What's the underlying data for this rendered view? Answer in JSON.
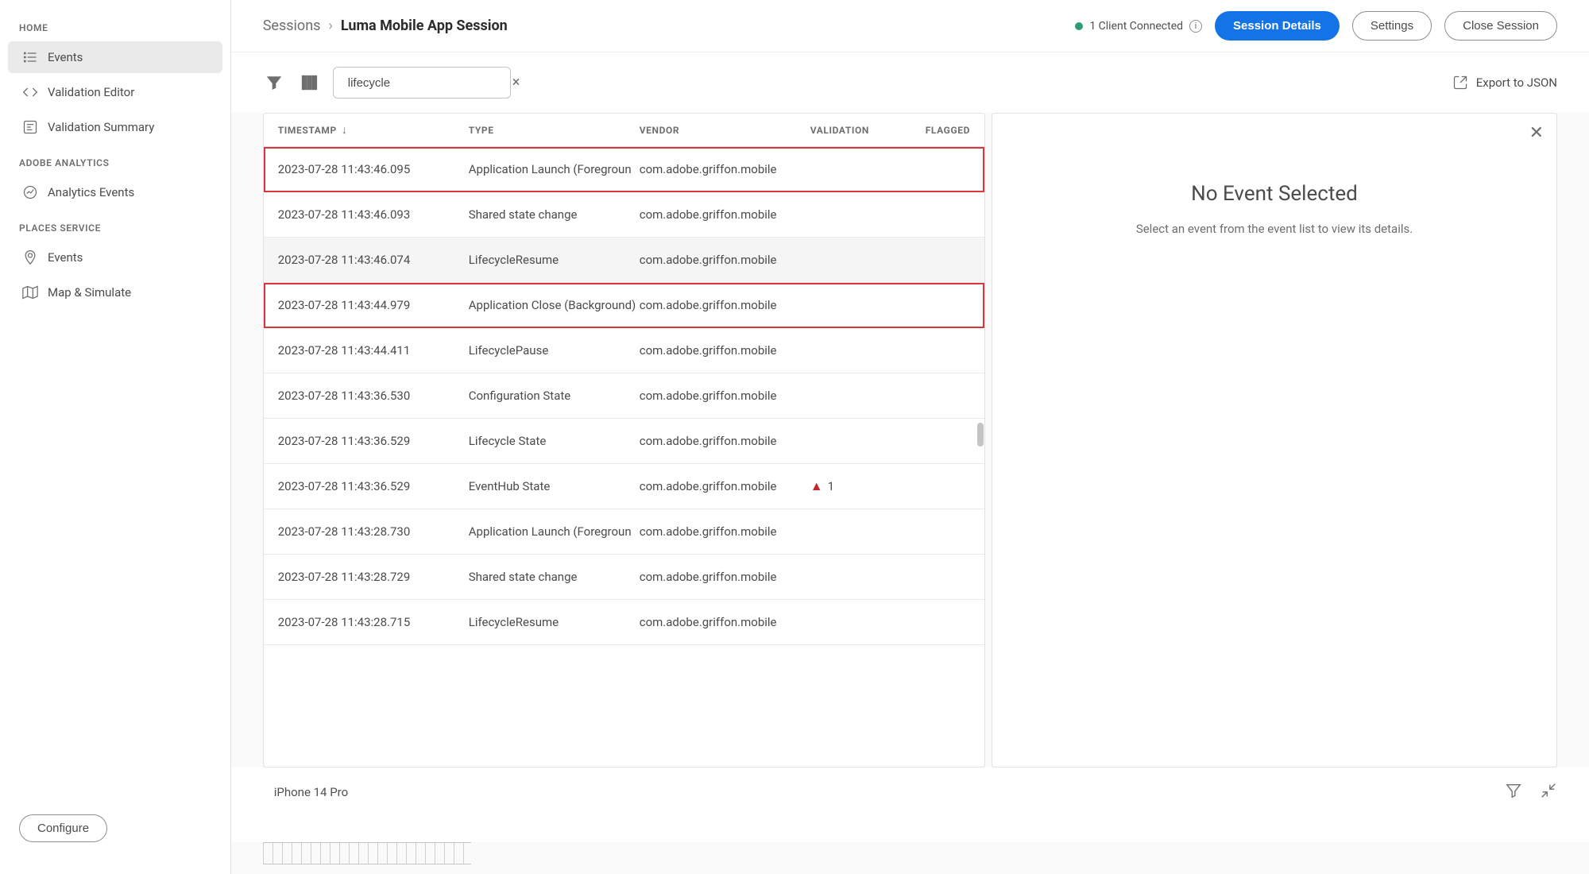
{
  "sidebar": {
    "sections": [
      {
        "title": "HOME",
        "items": [
          {
            "label": "Events",
            "icon": "events-list-icon",
            "active": true
          },
          {
            "label": "Validation Editor",
            "icon": "code-icon"
          },
          {
            "label": "Validation Summary",
            "icon": "summary-icon"
          }
        ]
      },
      {
        "title": "ADOBE ANALYTICS",
        "items": [
          {
            "label": "Analytics Events",
            "icon": "analytics-icon"
          }
        ]
      },
      {
        "title": "PLACES SERVICE",
        "items": [
          {
            "label": "Events",
            "icon": "pin-icon"
          },
          {
            "label": "Map & Simulate",
            "icon": "map-icon"
          }
        ]
      }
    ],
    "configure_label": "Configure"
  },
  "header": {
    "crumb_root": "Sessions",
    "crumb_current": "Luma Mobile App Session",
    "status_text": "1 Client Connected",
    "session_details": "Session Details",
    "settings": "Settings",
    "close_session": "Close Session"
  },
  "toolbar": {
    "search_value": "lifecycle",
    "export_label": "Export to JSON"
  },
  "table": {
    "columns": {
      "timestamp": "TIMESTAMP",
      "type": "TYPE",
      "vendor": "VENDOR",
      "validation": "VALIDATION",
      "flagged": "FLAGGED"
    },
    "rows": [
      {
        "ts": "2023-07-28 11:43:46.095",
        "type": "Application Launch (Foregroun",
        "vendor": "com.adobe.griffon.mobile",
        "highlight": true
      },
      {
        "ts": "2023-07-28 11:43:46.093",
        "type": "Shared state change",
        "vendor": "com.adobe.griffon.mobile"
      },
      {
        "ts": "2023-07-28 11:43:46.074",
        "type": "LifecycleResume",
        "vendor": "com.adobe.griffon.mobile",
        "alt": true
      },
      {
        "ts": "2023-07-28 11:43:44.979",
        "type": "Application Close (Background)",
        "vendor": "com.adobe.griffon.mobile",
        "highlight": true
      },
      {
        "ts": "2023-07-28 11:43:44.411",
        "type": "LifecyclePause",
        "vendor": "com.adobe.griffon.mobile"
      },
      {
        "ts": "2023-07-28 11:43:36.530",
        "type": "Configuration State",
        "vendor": "com.adobe.griffon.mobile"
      },
      {
        "ts": "2023-07-28 11:43:36.529",
        "type": "Lifecycle State",
        "vendor": "com.adobe.griffon.mobile"
      },
      {
        "ts": "2023-07-28 11:43:36.529",
        "type": "EventHub State",
        "vendor": "com.adobe.griffon.mobile",
        "validation_warn": "1"
      },
      {
        "ts": "2023-07-28 11:43:28.730",
        "type": "Application Launch (Foregroun",
        "vendor": "com.adobe.griffon.mobile"
      },
      {
        "ts": "2023-07-28 11:43:28.729",
        "type": "Shared state change",
        "vendor": "com.adobe.griffon.mobile"
      },
      {
        "ts": "2023-07-28 11:43:28.715",
        "type": "LifecycleResume",
        "vendor": "com.adobe.griffon.mobile"
      }
    ]
  },
  "details": {
    "title": "No Event Selected",
    "subtitle": "Select an event from the event list to view its details."
  },
  "footer": {
    "device": "iPhone 14 Pro"
  }
}
